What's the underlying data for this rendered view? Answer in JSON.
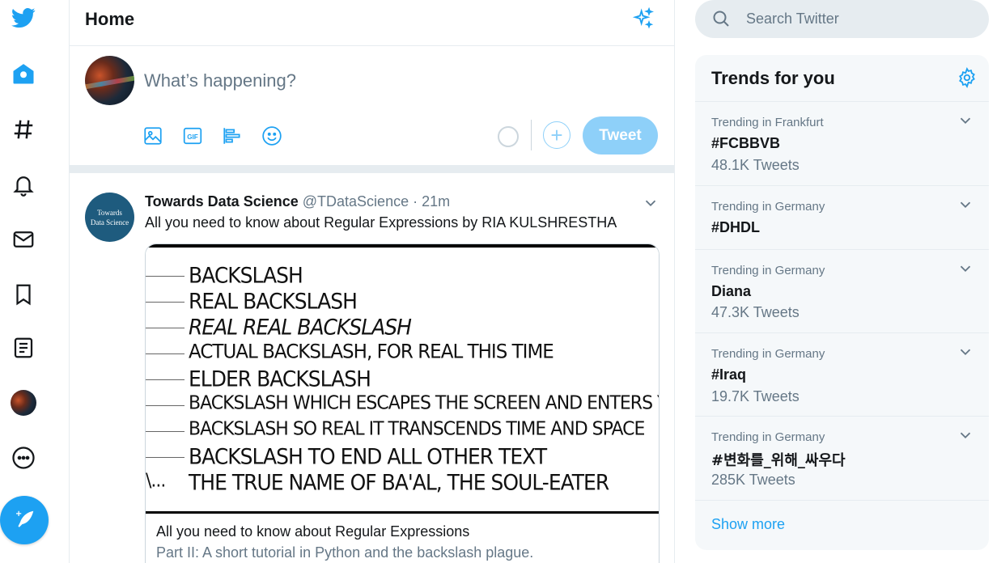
{
  "colors": {
    "brand": "#1da1f2",
    "brand_light": "#8ed0f9",
    "text": "#14171a",
    "muted": "#657786",
    "border": "#e6ecf0"
  },
  "nav": {
    "items": [
      {
        "icon": "twitter-logo-icon"
      },
      {
        "icon": "home-icon"
      },
      {
        "icon": "hashtag-icon"
      },
      {
        "icon": "bell-icon"
      },
      {
        "icon": "mail-icon"
      },
      {
        "icon": "bookmark-icon"
      },
      {
        "icon": "list-icon"
      },
      {
        "icon": "profile-avatar"
      },
      {
        "icon": "more-icon"
      }
    ],
    "compose_icon": "compose-tweet-icon"
  },
  "header": {
    "title": "Home",
    "sparkle_icon": "sparkle-icon"
  },
  "composer": {
    "placeholder": "What’s happening?",
    "tools": [
      "image-icon",
      "gif-icon",
      "poll-icon",
      "emoji-icon"
    ],
    "add_label": "+",
    "tweet_label": "Tweet"
  },
  "tweet": {
    "avatar_text_1": "Towards",
    "avatar_text_2": "Data Science",
    "name": "Towards Data Science",
    "handle": "@TDataScience",
    "separator": "·",
    "time": "21m",
    "text": "All you need to know about Regular Expressions by RIA KULSHRESTHA",
    "card": {
      "comic_lines": [
        "BACKSLASH",
        "REAL BACKSLASH",
        "REAL REAL BACKSLASH",
        "ACTUAL BACKSLASH, FOR REAL THIS TIME",
        "ELDER BACKSLASH",
        "BACKSLASH WHICH ESCAPES THE SCREEN AND ENTERS Y",
        "BACKSLASH SO REAL IT TRANSCENDS TIME AND SPACE",
        "BACKSLASH TO END ALL OTHER TEXT",
        "THE TRUE NAME OF BA'AL, THE SOUL-EATER"
      ],
      "last_prefix": "\\...",
      "title": "All you need to know about Regular Expressions",
      "description": "Part II: A short tutorial in Python and the backslash plague."
    }
  },
  "search": {
    "placeholder": "Search Twitter"
  },
  "trends": {
    "title": "Trends for you",
    "items": [
      {
        "meta": "Trending in Frankfurt",
        "name": "#FCBBVB",
        "count": "48.1K Tweets"
      },
      {
        "meta": "Trending in Germany",
        "name": "#DHDL",
        "count": ""
      },
      {
        "meta": "Trending in Germany",
        "name": "Diana",
        "count": "47.3K Tweets"
      },
      {
        "meta": "Trending in Germany",
        "name": "#Iraq",
        "count": "19.7K Tweets"
      },
      {
        "meta": "Trending in Germany",
        "name": "#변화를_위해_싸우다",
        "count": "285K Tweets"
      }
    ],
    "show_more": "Show more"
  }
}
